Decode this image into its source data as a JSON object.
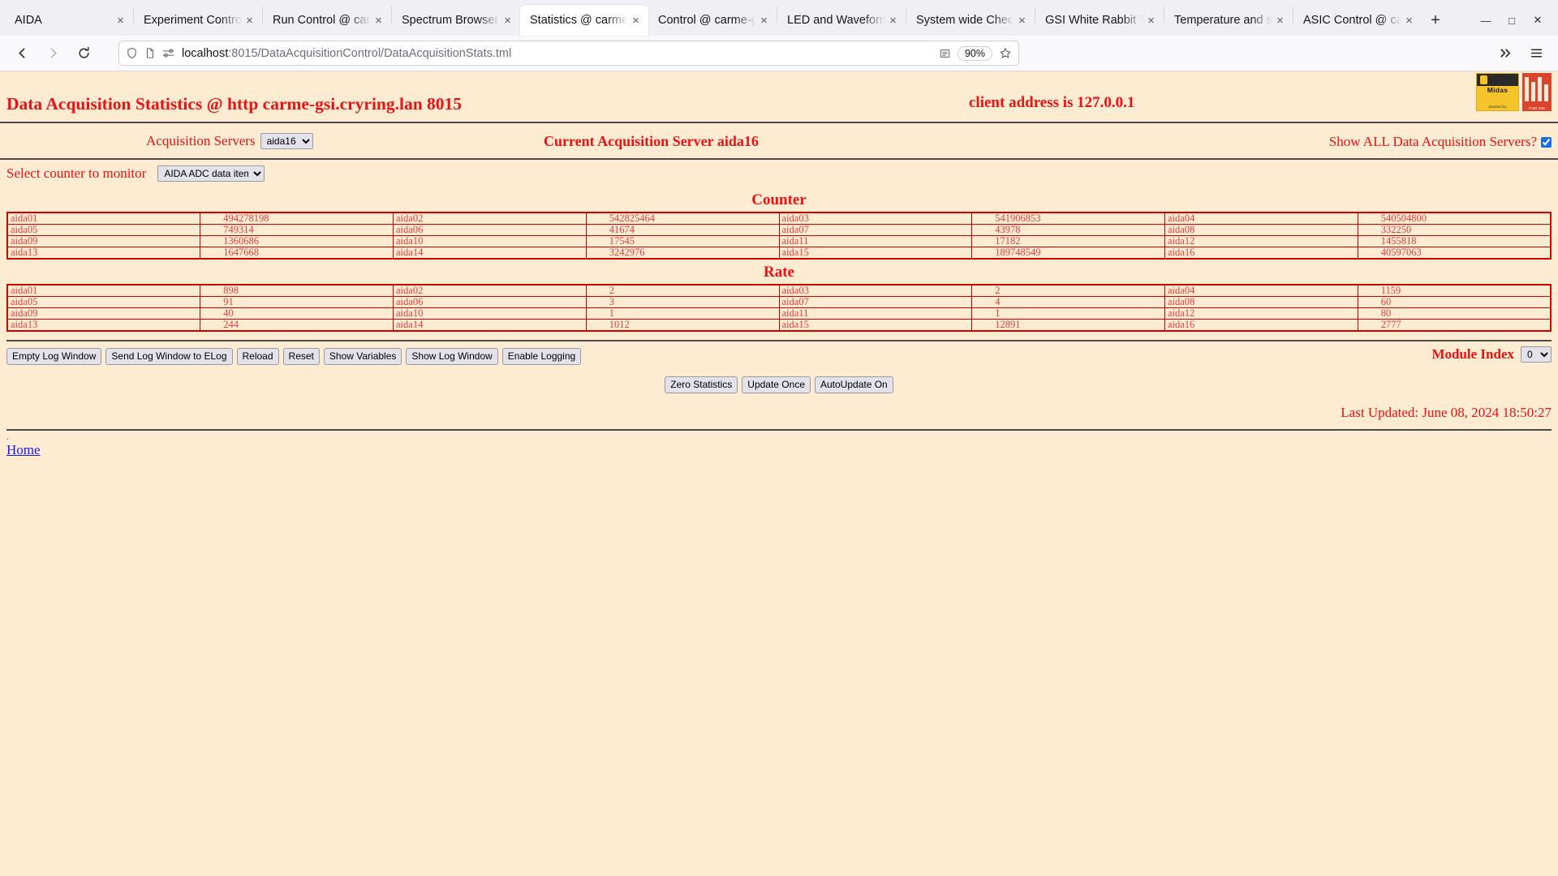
{
  "browser": {
    "tabs": [
      {
        "title": "AIDA",
        "active": false
      },
      {
        "title": "Experiment Control",
        "active": false
      },
      {
        "title": "Run Control @ carme",
        "active": false
      },
      {
        "title": "Spectrum Browser",
        "active": false
      },
      {
        "title": "Statistics @ carme",
        "active": true
      },
      {
        "title": "Control @ carme-gsi",
        "active": false
      },
      {
        "title": "LED and Waveform",
        "active": false
      },
      {
        "title": "System wide Check",
        "active": false
      },
      {
        "title": "GSI White Rabbit Ti",
        "active": false
      },
      {
        "title": "Temperature and st",
        "active": false
      },
      {
        "title": "ASIC Control @ car",
        "active": false
      }
    ],
    "tab_close_icon": "close-icon",
    "new_tab_label": "+",
    "window_controls": [
      "minimize",
      "maximize",
      "close"
    ],
    "nav": {
      "back": "back-icon",
      "forward": "forward-icon",
      "reload": "reload-icon",
      "shield": "shield-icon",
      "page": "page-icon",
      "permissions": "permissions-icon",
      "url_host": "localhost",
      "url_path": ":8015/DataAcquisitionControl/DataAcquisitionStats.tml",
      "reader_icon": "reader-view-icon",
      "zoom_level": "90%",
      "bookmark_icon": "star-icon",
      "overflow_icon": "chevrons-right-icon",
      "menu_icon": "hamburger-menu-icon"
    }
  },
  "page": {
    "title": "Data Acquisition Statistics @ http carme-gsi.cryring.lan 8015",
    "client_address": "client address is 127.0.0.1",
    "logos": {
      "midas_word": "Midas",
      "midas_sub": "powered by",
      "gsi_text": "FAIR GSI"
    },
    "acquisition_servers_label": "Acquisition Servers",
    "acquisition_servers_value": "aida16",
    "current_server": "Current Acquisition Server aida16",
    "show_all_label": "Show ALL Data Acquisition Servers?",
    "show_all_checked": true,
    "select_counter_label": "Select counter to monitor",
    "counter_select_value": "AIDA ADC data items",
    "counter_heading": "Counter",
    "rate_heading": "Rate",
    "counter_rows": [
      [
        [
          "aida01",
          "494278198"
        ],
        [
          "aida02",
          "542825464"
        ],
        [
          "aida03",
          "541906853"
        ],
        [
          "aida04",
          "540504800"
        ]
      ],
      [
        [
          "aida05",
          "749314"
        ],
        [
          "aida06",
          "41674"
        ],
        [
          "aida07",
          "43978"
        ],
        [
          "aida08",
          "332250"
        ]
      ],
      [
        [
          "aida09",
          "1360686"
        ],
        [
          "aida10",
          "17545"
        ],
        [
          "aida11",
          "17182"
        ],
        [
          "aida12",
          "1455818"
        ]
      ],
      [
        [
          "aida13",
          "1647668"
        ],
        [
          "aida14",
          "3242976"
        ],
        [
          "aida15",
          "189748549"
        ],
        [
          "aida16",
          "40597063"
        ]
      ]
    ],
    "rate_rows": [
      [
        [
          "aida01",
          "898"
        ],
        [
          "aida02",
          "2"
        ],
        [
          "aida03",
          "2"
        ],
        [
          "aida04",
          "1159"
        ]
      ],
      [
        [
          "aida05",
          "91"
        ],
        [
          "aida06",
          "3"
        ],
        [
          "aida07",
          "4"
        ],
        [
          "aida08",
          "60"
        ]
      ],
      [
        [
          "aida09",
          "40"
        ],
        [
          "aida10",
          "1"
        ],
        [
          "aida11",
          "1"
        ],
        [
          "aida12",
          "80"
        ]
      ],
      [
        [
          "aida13",
          "244"
        ],
        [
          "aida14",
          "1012"
        ],
        [
          "aida15",
          "12891"
        ],
        [
          "aida16",
          "2777"
        ]
      ]
    ],
    "log_buttons": [
      "Empty Log Window",
      "Send Log Window to ELog",
      "Reload",
      "Reset",
      "Show Variables",
      "Show Log Window",
      "Enable Logging"
    ],
    "module_index_label": "Module Index",
    "module_index_value": "0",
    "action_buttons": [
      "Zero Statistics",
      "Update Once",
      "AutoUpdate On"
    ],
    "last_updated": "Last Updated: June 08, 2024 18:50:27",
    "dot": ".",
    "home_link": "Home"
  }
}
